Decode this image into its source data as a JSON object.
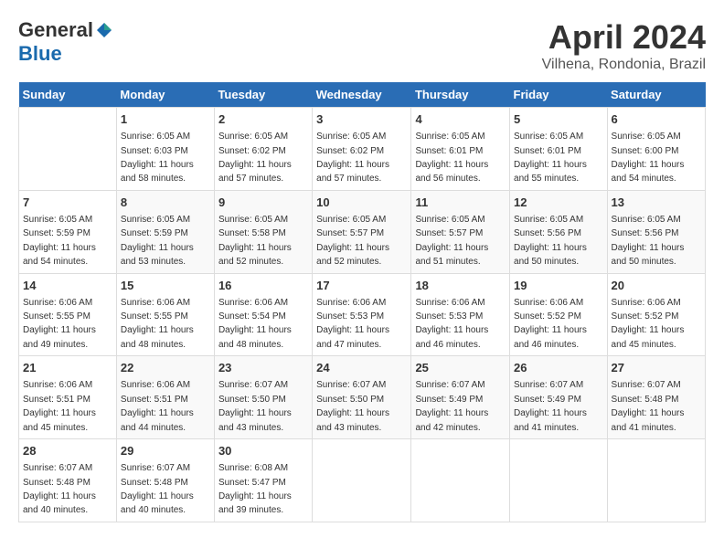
{
  "header": {
    "logo_general": "General",
    "logo_blue": "Blue",
    "month_title": "April 2024",
    "subtitle": "Vilhena, Rondonia, Brazil"
  },
  "weekdays": [
    "Sunday",
    "Monday",
    "Tuesday",
    "Wednesday",
    "Thursday",
    "Friday",
    "Saturday"
  ],
  "weeks": [
    [
      {
        "day": "",
        "info": ""
      },
      {
        "day": "1",
        "info": "Sunrise: 6:05 AM\nSunset: 6:03 PM\nDaylight: 11 hours\nand 58 minutes."
      },
      {
        "day": "2",
        "info": "Sunrise: 6:05 AM\nSunset: 6:02 PM\nDaylight: 11 hours\nand 57 minutes."
      },
      {
        "day": "3",
        "info": "Sunrise: 6:05 AM\nSunset: 6:02 PM\nDaylight: 11 hours\nand 57 minutes."
      },
      {
        "day": "4",
        "info": "Sunrise: 6:05 AM\nSunset: 6:01 PM\nDaylight: 11 hours\nand 56 minutes."
      },
      {
        "day": "5",
        "info": "Sunrise: 6:05 AM\nSunset: 6:01 PM\nDaylight: 11 hours\nand 55 minutes."
      },
      {
        "day": "6",
        "info": "Sunrise: 6:05 AM\nSunset: 6:00 PM\nDaylight: 11 hours\nand 54 minutes."
      }
    ],
    [
      {
        "day": "7",
        "info": "Sunrise: 6:05 AM\nSunset: 5:59 PM\nDaylight: 11 hours\nand 54 minutes."
      },
      {
        "day": "8",
        "info": "Sunrise: 6:05 AM\nSunset: 5:59 PM\nDaylight: 11 hours\nand 53 minutes."
      },
      {
        "day": "9",
        "info": "Sunrise: 6:05 AM\nSunset: 5:58 PM\nDaylight: 11 hours\nand 52 minutes."
      },
      {
        "day": "10",
        "info": "Sunrise: 6:05 AM\nSunset: 5:57 PM\nDaylight: 11 hours\nand 52 minutes."
      },
      {
        "day": "11",
        "info": "Sunrise: 6:05 AM\nSunset: 5:57 PM\nDaylight: 11 hours\nand 51 minutes."
      },
      {
        "day": "12",
        "info": "Sunrise: 6:05 AM\nSunset: 5:56 PM\nDaylight: 11 hours\nand 50 minutes."
      },
      {
        "day": "13",
        "info": "Sunrise: 6:05 AM\nSunset: 5:56 PM\nDaylight: 11 hours\nand 50 minutes."
      }
    ],
    [
      {
        "day": "14",
        "info": "Sunrise: 6:06 AM\nSunset: 5:55 PM\nDaylight: 11 hours\nand 49 minutes."
      },
      {
        "day": "15",
        "info": "Sunrise: 6:06 AM\nSunset: 5:55 PM\nDaylight: 11 hours\nand 48 minutes."
      },
      {
        "day": "16",
        "info": "Sunrise: 6:06 AM\nSunset: 5:54 PM\nDaylight: 11 hours\nand 48 minutes."
      },
      {
        "day": "17",
        "info": "Sunrise: 6:06 AM\nSunset: 5:53 PM\nDaylight: 11 hours\nand 47 minutes."
      },
      {
        "day": "18",
        "info": "Sunrise: 6:06 AM\nSunset: 5:53 PM\nDaylight: 11 hours\nand 46 minutes."
      },
      {
        "day": "19",
        "info": "Sunrise: 6:06 AM\nSunset: 5:52 PM\nDaylight: 11 hours\nand 46 minutes."
      },
      {
        "day": "20",
        "info": "Sunrise: 6:06 AM\nSunset: 5:52 PM\nDaylight: 11 hours\nand 45 minutes."
      }
    ],
    [
      {
        "day": "21",
        "info": "Sunrise: 6:06 AM\nSunset: 5:51 PM\nDaylight: 11 hours\nand 45 minutes."
      },
      {
        "day": "22",
        "info": "Sunrise: 6:06 AM\nSunset: 5:51 PM\nDaylight: 11 hours\nand 44 minutes."
      },
      {
        "day": "23",
        "info": "Sunrise: 6:07 AM\nSunset: 5:50 PM\nDaylight: 11 hours\nand 43 minutes."
      },
      {
        "day": "24",
        "info": "Sunrise: 6:07 AM\nSunset: 5:50 PM\nDaylight: 11 hours\nand 43 minutes."
      },
      {
        "day": "25",
        "info": "Sunrise: 6:07 AM\nSunset: 5:49 PM\nDaylight: 11 hours\nand 42 minutes."
      },
      {
        "day": "26",
        "info": "Sunrise: 6:07 AM\nSunset: 5:49 PM\nDaylight: 11 hours\nand 41 minutes."
      },
      {
        "day": "27",
        "info": "Sunrise: 6:07 AM\nSunset: 5:48 PM\nDaylight: 11 hours\nand 41 minutes."
      }
    ],
    [
      {
        "day": "28",
        "info": "Sunrise: 6:07 AM\nSunset: 5:48 PM\nDaylight: 11 hours\nand 40 minutes."
      },
      {
        "day": "29",
        "info": "Sunrise: 6:07 AM\nSunset: 5:48 PM\nDaylight: 11 hours\nand 40 minutes."
      },
      {
        "day": "30",
        "info": "Sunrise: 6:08 AM\nSunset: 5:47 PM\nDaylight: 11 hours\nand 39 minutes."
      },
      {
        "day": "",
        "info": ""
      },
      {
        "day": "",
        "info": ""
      },
      {
        "day": "",
        "info": ""
      },
      {
        "day": "",
        "info": ""
      }
    ]
  ]
}
